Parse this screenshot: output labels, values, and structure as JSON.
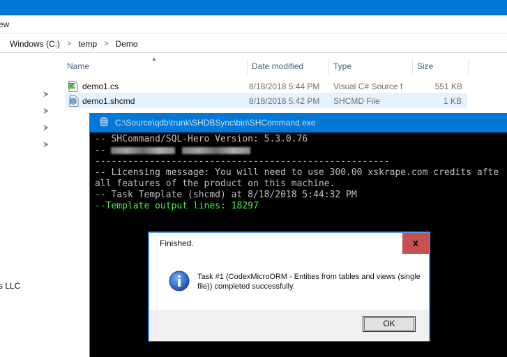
{
  "explorer": {
    "menu_view": "ew",
    "breadcrumb": [
      "Windows (C:)",
      "temp",
      "Demo"
    ],
    "nav_truncated_label": "s LLC",
    "columns": {
      "name": "Name",
      "date": "Date modified",
      "type": "Type",
      "size": "Size"
    },
    "files": [
      {
        "name": "demo1.cs",
        "date": "8/18/2018 5:44 PM",
        "type": "Visual C# Source f",
        "size": "551 KB",
        "icon": "csharp-file-icon"
      },
      {
        "name": "demo1.shcmd",
        "date": "8/18/2018 5:42 PM",
        "type": "SHCMD File",
        "size": "1 KB",
        "icon": "shcmd-file-icon"
      }
    ]
  },
  "console": {
    "title": "C:\\Source\\qdb\\trunk\\SHDBSync\\bin\\SHCommand.exe",
    "lines": {
      "l1": "-- SHCommand/SQL-Hero Version: 5.3.0.76",
      "l2_prefix": "-- ",
      "l3": "------------------------------------------------------",
      "l4": "-- Licensing message: You will need to use 300.00 xskrape.com credits afte",
      "l5": "all features of the product on this machine.",
      "l6": "-- Task Template (shcmd) at 8/18/2018 5:44:32 PM",
      "l7": "--Template output lines: 18297"
    }
  },
  "dialog": {
    "title": "Finished.",
    "close_label": "x",
    "message": "Task #1 (CodexMicroORM - Entities from tables and views (single file)) completed successfully.",
    "ok_label": "OK"
  },
  "colors": {
    "accent": "#0078d7",
    "console_text": "#c0c0c0",
    "console_green": "#4af04a",
    "close_red": "#c75050"
  }
}
